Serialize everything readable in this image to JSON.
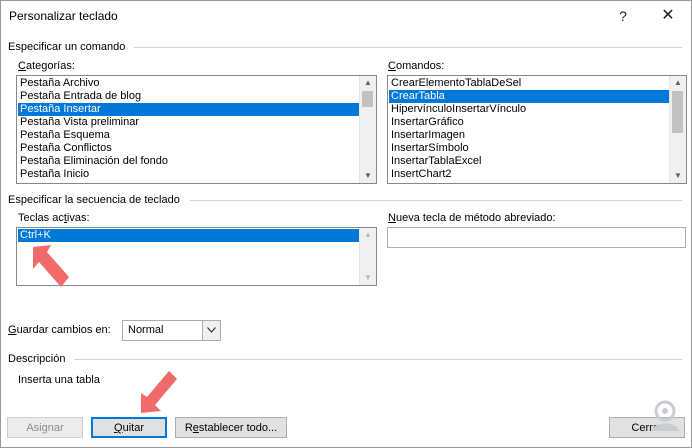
{
  "window": {
    "title": "Personalizar teclado",
    "help_glyph": "?",
    "close_glyph": "✕"
  },
  "section_command": {
    "label": "Especificar un comando"
  },
  "categories": {
    "label_accel": "C",
    "label_rest": "ategorías:",
    "items": [
      "Pestaña Archivo",
      "Pestaña Entrada de blog",
      "Pestaña Insertar",
      "Pestaña Vista preliminar",
      "Pestaña Esquema",
      "Pestaña Conflictos",
      "Pestaña Eliminación del fondo",
      "Pestaña Inicio"
    ],
    "selected_index": 2
  },
  "commands": {
    "label_accel": "C",
    "label_rest": "omandos:",
    "items": [
      "CrearElementoTablaDeSel",
      "CrearTabla",
      "HipervínculoInsertarVínculo",
      "InsertarGráfico",
      "InsertarImagen",
      "InsertarSímbolo",
      "InsertarTablaExcel",
      "InsertChart2"
    ],
    "selected_index": 1
  },
  "section_keys": {
    "label": "Especificar la secuencia de teclado"
  },
  "active_keys": {
    "label_pre": "Teclas ac",
    "label_accel": "t",
    "label_post": "ivas:",
    "items": [
      "Ctrl+K"
    ],
    "selected_index": 0
  },
  "new_shortcut": {
    "label_accel": "N",
    "label_rest": "ueva tecla de método abreviado:",
    "value": ""
  },
  "save_changes": {
    "label_accel": "G",
    "label_rest": "uardar cambios en:",
    "value": "Normal"
  },
  "description": {
    "label": "Descripción",
    "text": "Inserta una tabla"
  },
  "buttons": {
    "assign": "Asignar",
    "remove_accel": "Q",
    "remove_rest": "uitar",
    "reset_pre": "R",
    "reset_accel": "e",
    "reset_post": "stablecer todo...",
    "close": "Cerrar"
  },
  "colors": {
    "selection": "#0078d7",
    "annotation_arrow": "#f26b6b",
    "default_button_border": "#0078d7"
  },
  "icons": {
    "annotation": "arrow-annotation-icon",
    "dropdown": "chevron-down-icon"
  }
}
